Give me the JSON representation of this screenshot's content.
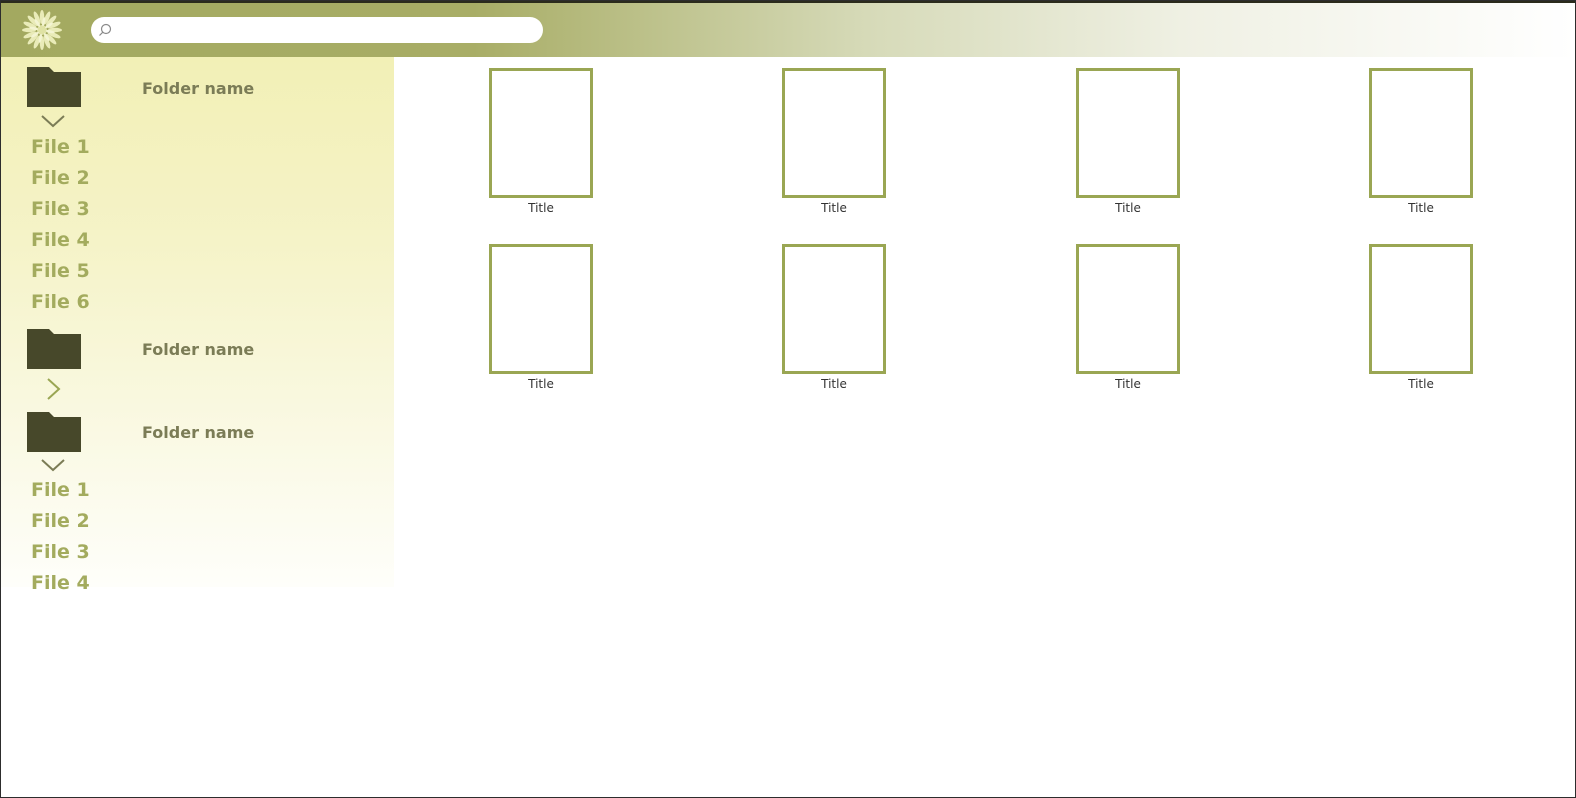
{
  "search": {
    "placeholder": "",
    "value": ""
  },
  "sidebar": {
    "folders": [
      {
        "label": "Folder name",
        "expanded": true,
        "files": [
          "File 1",
          "File 2",
          "File 3",
          "File 4",
          "File 5",
          "File 6"
        ]
      },
      {
        "label": "Folder name",
        "expanded": false,
        "files": []
      },
      {
        "label": "Folder name",
        "expanded": true,
        "files": [
          "File 1",
          "File 2",
          "File 3",
          "File 4"
        ]
      }
    ]
  },
  "grid": {
    "items": [
      {
        "title": "Title"
      },
      {
        "title": "Title"
      },
      {
        "title": "Title"
      },
      {
        "title": "Title"
      },
      {
        "title": "Title"
      },
      {
        "title": "Title"
      },
      {
        "title": "Title"
      },
      {
        "title": "Title"
      }
    ]
  },
  "colors": {
    "accent": "#9aa653",
    "file_text": "#a3ab5e",
    "folder_icon": "#47482a",
    "folder_label": "#7b7c56"
  },
  "icons": {
    "logo": "flower-logo-icon",
    "search": "search-icon",
    "folder": "folder-icon",
    "expanded": "chevron-down-icon",
    "collapsed": "chevron-right-icon"
  }
}
